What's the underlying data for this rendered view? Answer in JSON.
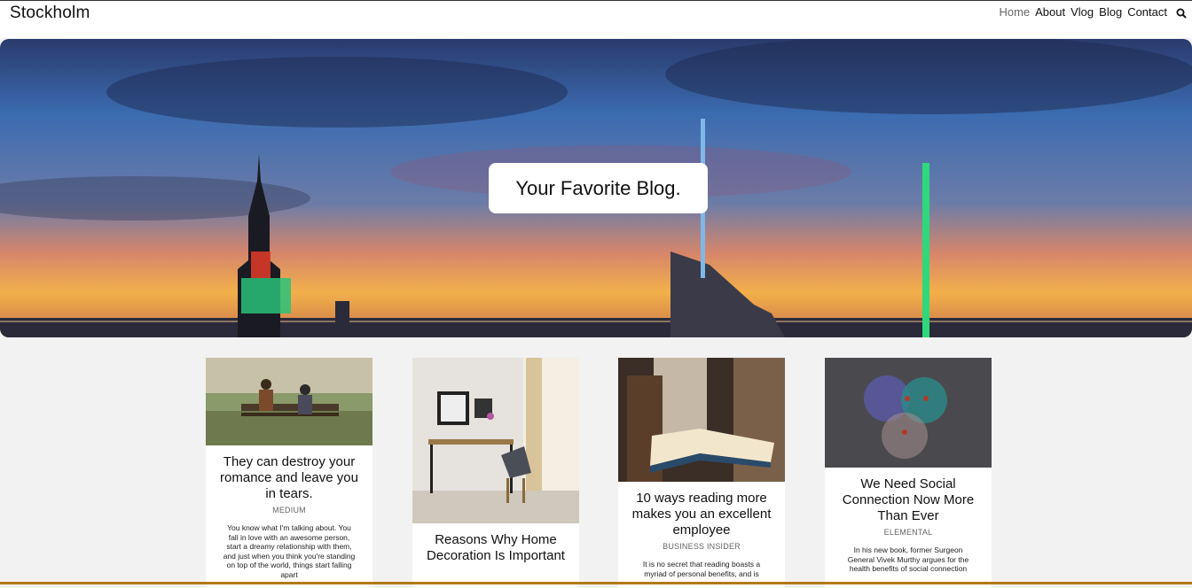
{
  "brand": "Stockholm",
  "nav": {
    "items": [
      "Home",
      "About",
      "Vlog",
      "Blog",
      "Contact"
    ],
    "search_icon": "search-icon"
  },
  "hero": {
    "tagline": "Your Favorite Blog."
  },
  "cards": [
    {
      "title": "They can destroy your romance and leave you in tears.",
      "source": "MEDIUM",
      "excerpt": "You know what I'm talking about. You fall in love with an awesome person, start a dreamy relationship with them, and just when you think you're standing on top of the world, things start falling apart"
    },
    {
      "title": "Reasons Why Home Decoration Is Important",
      "source": "",
      "excerpt": ""
    },
    {
      "title": "10 ways reading more makes you an excellent employee",
      "source": "BUSINESS INSIDER",
      "excerpt": "It is no secret that reading boasts a myriad of personal benefits, and is"
    },
    {
      "title": "We Need Social Connection Now More Than Ever",
      "source": "ELEMENTAL",
      "excerpt": "In his new book, former Surgeon General Vivek Murthy argues for the health benefits of social connection"
    }
  ],
  "colors": {
    "page_bg": "#f2f2f2",
    "card_bg": "#ffffff",
    "accent_line": "#b27a1a"
  }
}
